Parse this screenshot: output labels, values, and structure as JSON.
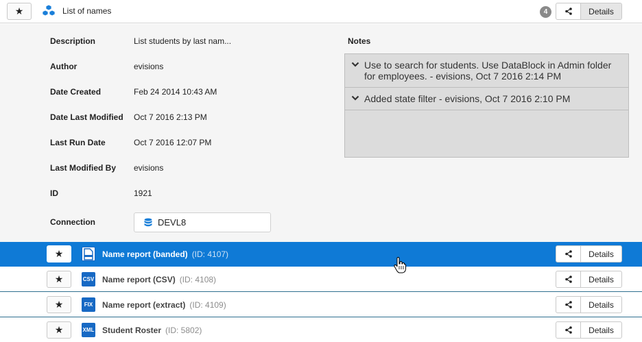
{
  "header": {
    "title": "List of names",
    "badge_count": "4",
    "details_label": "Details",
    "star": "★"
  },
  "properties": [
    {
      "label": "Description",
      "value": "List students by last nam..."
    },
    {
      "label": "Author",
      "value": "evisions"
    },
    {
      "label": "Date Created",
      "value": "Feb 24 2014 10:43 AM"
    },
    {
      "label": "Date Last Modified",
      "value": "Oct 7 2016 2:13 PM"
    },
    {
      "label": "Last Run Date",
      "value": "Oct 7 2016 12:07 PM"
    },
    {
      "label": "Last Modified By",
      "value": "evisions"
    },
    {
      "label": "ID",
      "value": "1921"
    }
  ],
  "connection": {
    "label": "Connection",
    "value": "DEVL8"
  },
  "notes": {
    "label": "Notes",
    "items": [
      "Use to search for students. Use DataBlock in Admin folder for employees. - evisions, Oct 7 2016 2:14 PM",
      "Added state filter - evisions, Oct 7 2016 2:10 PM"
    ]
  },
  "reports": [
    {
      "name": "Name report (banded)",
      "id": "(ID: 4107)",
      "icon": "",
      "icon_name": "banded-report-icon",
      "selected": true
    },
    {
      "name": "Name report (CSV)",
      "id": "(ID: 4108)",
      "icon": "CSV",
      "icon_name": "csv-file-icon",
      "selected": false
    },
    {
      "name": "Name report (extract)",
      "id": "(ID: 4109)",
      "icon": "FIX",
      "icon_name": "fixed-width-file-icon",
      "selected": false
    },
    {
      "name": "Student Roster",
      "id": "(ID: 5802)",
      "icon": "XML",
      "icon_name": "xml-file-icon",
      "selected": false
    }
  ],
  "row_details_label": "Details",
  "colors": {
    "selected_row": "#0f7ad6",
    "panel_bg": "#f5f5f5",
    "notes_bg": "#dcdcdc",
    "file_icon": "#1769c4",
    "badge": "#8a8a8a"
  }
}
